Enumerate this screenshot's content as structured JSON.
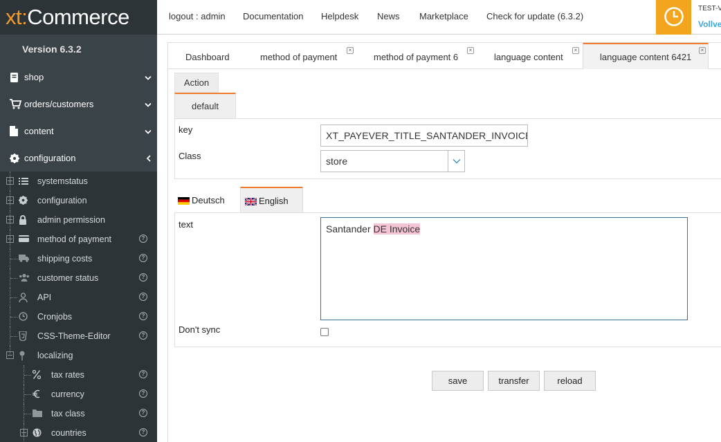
{
  "app": {
    "logo_part1": "xt:",
    "logo_part2": "Commerce",
    "version": "Version 6.3.2"
  },
  "topbar": {
    "links": [
      "logout : admin",
      "Documentation",
      "Helpdesk",
      "News",
      "Marketplace",
      "Check for update (6.3.2)"
    ],
    "user_line1": "TEST-V",
    "user_line2": "Vollve",
    "accent_color": "#f3a51e"
  },
  "sidebar": {
    "menu": [
      {
        "label": "shop",
        "icon": "book-icon",
        "chevron": "down"
      },
      {
        "label": "orders/customers",
        "icon": "cart-icon",
        "chevron": "down"
      },
      {
        "label": "content",
        "icon": "document-icon",
        "chevron": "down"
      },
      {
        "label": "configuration",
        "icon": "gear-icon",
        "chevron": "left"
      }
    ],
    "tree": [
      {
        "label": "systemstatus",
        "icon": "list-icon"
      },
      {
        "label": "configuration",
        "icon": "gear-icon"
      },
      {
        "label": "admin permission",
        "icon": "lock-icon"
      },
      {
        "label": "method of payment",
        "icon": "card-icon"
      },
      {
        "label": "shipping costs",
        "icon": "truck-icon"
      },
      {
        "label": "customer status",
        "icon": "users-icon"
      },
      {
        "label": "API",
        "icon": "user-tie-icon"
      },
      {
        "label": "Cronjobs",
        "icon": "clock-icon"
      },
      {
        "label": "CSS-Theme-Editor",
        "icon": "css-icon"
      },
      {
        "label": "localizing",
        "icon": "pin-icon"
      },
      {
        "label": "tax rates",
        "icon": "percent-icon"
      },
      {
        "label": "currency",
        "icon": "euro-icon"
      },
      {
        "label": "tax class",
        "icon": "folder-icon"
      },
      {
        "label": "countries",
        "icon": "globe-icon"
      }
    ]
  },
  "tabs": [
    {
      "label": "Dashboard",
      "closable": false,
      "active": false
    },
    {
      "label": "method of payment",
      "closable": true,
      "active": false
    },
    {
      "label": "method of payment 6",
      "closable": true,
      "active": false
    },
    {
      "label": "language content",
      "closable": true,
      "active": false
    },
    {
      "label": "language content 6421",
      "closable": true,
      "active": true
    }
  ],
  "form": {
    "action_label": "Action",
    "default_tab": "default",
    "key_label": "key",
    "key_value": "XT_PAYEVER_TITLE_SANTANDER_INVOICE_DE",
    "class_label": "Class",
    "class_value": "store",
    "lang_tabs": [
      "Deutsch",
      "English"
    ],
    "text_label": "text",
    "text_value_plain": "Santander ",
    "text_value_highlight": "DE Invoice",
    "dont_sync_label": "Don't sync",
    "dont_sync_checked": false
  },
  "buttons": {
    "save": "save",
    "transfer": "transfer",
    "reload": "reload"
  }
}
